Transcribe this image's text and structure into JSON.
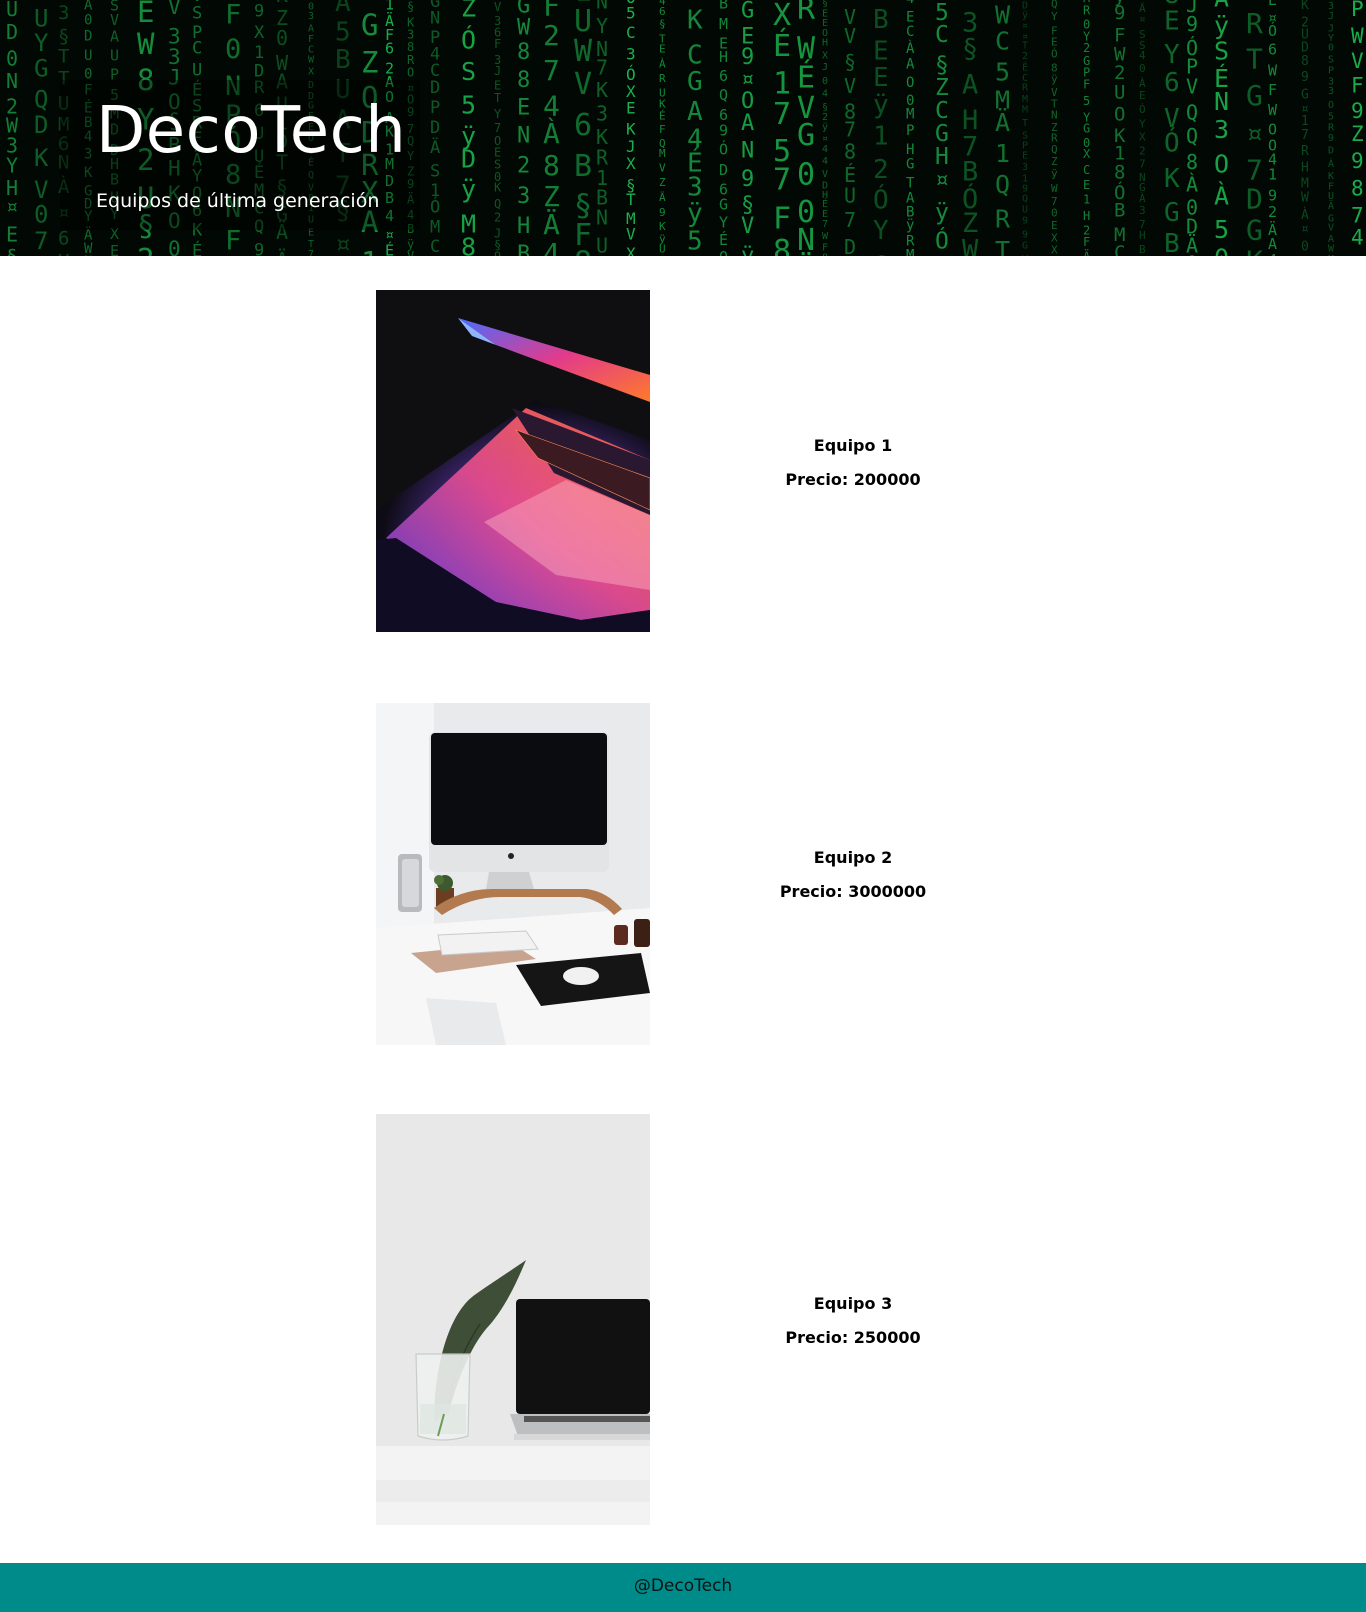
{
  "header": {
    "title": "DecoTech",
    "subtitle": "Equipos de última generación"
  },
  "products": [
    {
      "name": "Equipo 1",
      "price": "Precio: 200000",
      "image": "laptop-keyboard-colorful"
    },
    {
      "name": "Equipo 2",
      "price": "Precio: 3000000",
      "image": "desktop-computer-desk"
    },
    {
      "name": "Equipo 3",
      "price": "Precio: 250000",
      "image": "laptop-with-plant"
    }
  ],
  "footer": {
    "text": "@DecoTech"
  },
  "colors": {
    "header_bg": "#020803",
    "code_green": "#1fd15a",
    "footer_bg": "#008b8b",
    "page_bg": "#ffffff"
  }
}
